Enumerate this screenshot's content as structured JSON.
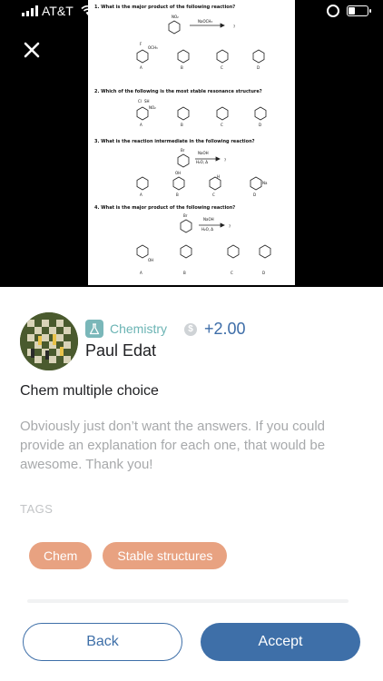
{
  "status_bar": {
    "carrier": "AT&T"
  },
  "worksheet": {
    "q1": "1. What is the major product of the following reaction?",
    "q1_reagent": "NaOCH₃",
    "q2": "2. Which of the following is the most stable resonance structure?",
    "q3": "3. What is the reaction intermediate in the following reaction?",
    "q3_reagent": "NaOH",
    "q3_cond": "H₂O, Δ",
    "q4": "4. What is the major product of the following reaction?",
    "q4_reagent": "NaOH",
    "q4_cond": "H₂O, Δ",
    "answer_letters": [
      "A",
      "B",
      "C",
      "D"
    ],
    "q1_labels": [
      "NO₂",
      "OCH₃",
      "F"
    ],
    "q2_labels": [
      "Cl",
      "SH",
      "NO₂"
    ],
    "q3_labels": [
      "Br",
      "OH",
      "H",
      "Na"
    ],
    "q4_labels": [
      "Br",
      "OH"
    ],
    "unknown_product": "?"
  },
  "question": {
    "subject": "Chemistry",
    "price": "+2.00",
    "author": "Paul Edat",
    "title": "Chem multiple choice",
    "description": "Obviously just don’t want the answers. If you could provide an explanation for each one, that would be awesome. Thank you!",
    "tags_heading": "TAGS",
    "tags": [
      "Chem",
      "Stable structures"
    ]
  },
  "actions": {
    "back": "Back",
    "accept": "Accept"
  },
  "colors": {
    "primary": "#3e6fa8",
    "tag": "#e8a281",
    "subject": "#6bb4b4"
  }
}
